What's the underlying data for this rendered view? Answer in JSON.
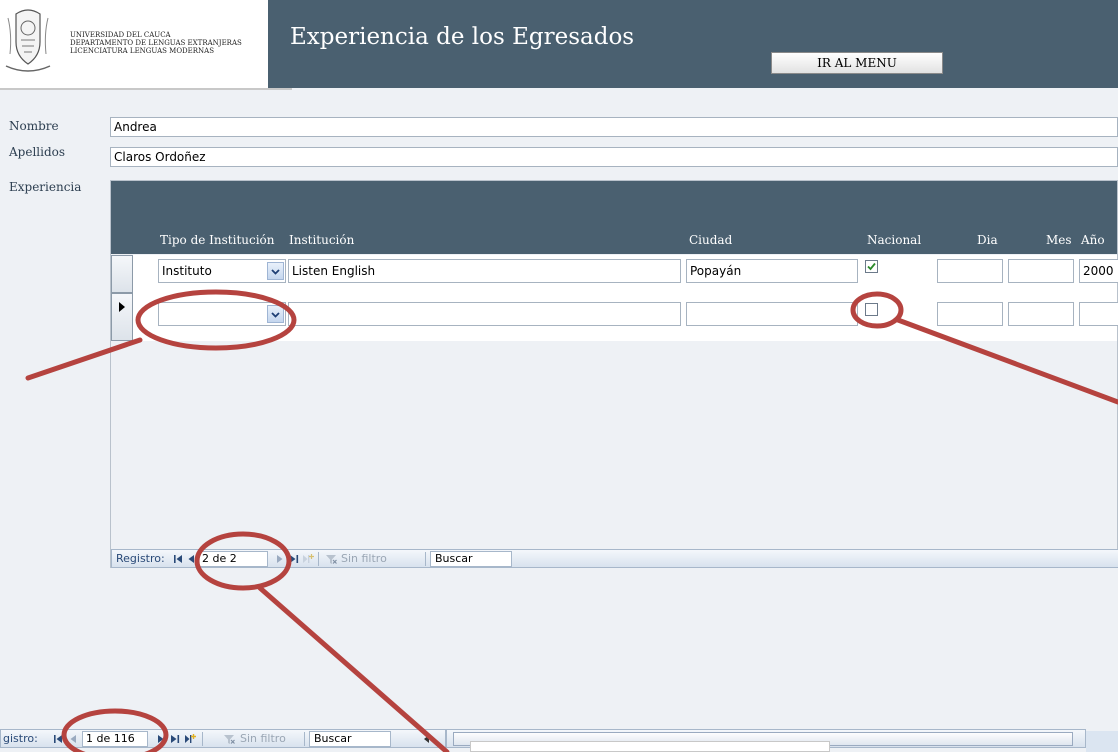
{
  "header": {
    "university_line1": "UNIVERSIDAD DEL CAUCA",
    "university_line2": "DEPARTAMENTO DE LENGUAS EXTRANJERAS",
    "university_line3": "LICENCIATURA LENGUAS MODERNAS",
    "title": "Experiencia de los Egresados",
    "menu_button": "IR AL MENU",
    "bar_color": "#4a6070"
  },
  "form": {
    "nombre_label": "Nombre",
    "nombre_value": "Andrea",
    "apellidos_label": "Apellidos",
    "apellidos_value": "Claros Ordoñez",
    "experiencia_label": "Experiencia"
  },
  "subform": {
    "columns": {
      "tipo": "Tipo de Institución",
      "institucion": "Institución",
      "ciudad": "Ciudad",
      "nacional": "Nacional",
      "dia": "Dia",
      "mes": "Mes",
      "anio": "Año"
    },
    "rows": [
      {
        "tipo": "Instituto",
        "institucion": "Listen English",
        "ciudad": "Popayán",
        "nacional": true,
        "dia": "",
        "mes": "",
        "anio": "2000"
      },
      {
        "tipo": "",
        "institucion": "",
        "ciudad": "",
        "nacional": false,
        "dia": "",
        "mes": "",
        "anio": ""
      }
    ],
    "nav": {
      "label": "Registro:",
      "position": "2 de 2",
      "filter": "Sin filtro",
      "search": "Buscar"
    }
  },
  "main_nav": {
    "label": "gistro:",
    "position": "1 de 116",
    "filter": "Sin filtro",
    "search": "Buscar"
  },
  "annotation_color": "#b5433f"
}
